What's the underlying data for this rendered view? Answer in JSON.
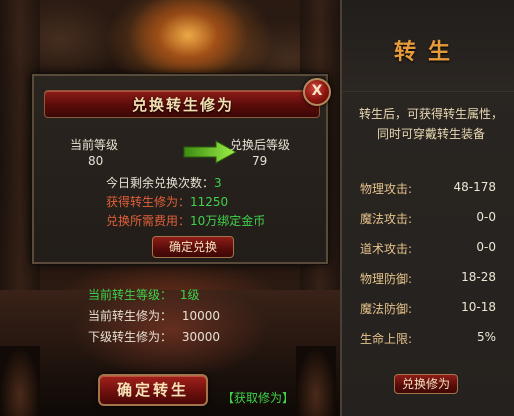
{
  "dialog": {
    "title": "兑换转生修为",
    "close_label": "X",
    "current_level_label": "当前等级",
    "current_level_value": "80",
    "after_level_label": "兑换后等级",
    "after_level_value": "79",
    "remaining_label": "今日剩余兑换次数：",
    "remaining_value": "3",
    "gain_label": "获得转生修为：",
    "gain_value": "11250",
    "cost_label": "兑换所需费用：",
    "cost_value": "10万绑定金币",
    "confirm_label": "确定兑换"
  },
  "scene": {
    "rebirth_level_label": "当前转生等级：",
    "rebirth_level_value": "1级",
    "current_cultivation_label": "当前转生修为：",
    "current_cultivation_value": "10000",
    "next_cultivation_label": "下级转生修为：",
    "next_cultivation_value": "30000",
    "confirm_rebirth_label": "确定转生",
    "get_link_label": "【获取修为】"
  },
  "panel": {
    "title": "转生",
    "description": "转生后，可获得转生属性，同时可穿戴转生装备",
    "stats": [
      {
        "name": "物理攻击:",
        "value": "48-178"
      },
      {
        "name": "魔法攻击:",
        "value": "0-0"
      },
      {
        "name": "道术攻击:",
        "value": "0-0"
      },
      {
        "name": "物理防御:",
        "value": "18-28"
      },
      {
        "name": "魔法防御:",
        "value": "10-18"
      },
      {
        "name": "生命上限:",
        "value": "5%"
      }
    ],
    "exchange_button_label": "兑换修为"
  },
  "colors": {
    "green_text": "#3fd24a",
    "title_orange": "#e79a3a",
    "button_red": "#8e1d18"
  },
  "icons": {
    "close": "close-icon",
    "arrow": "arrow-right-icon"
  }
}
